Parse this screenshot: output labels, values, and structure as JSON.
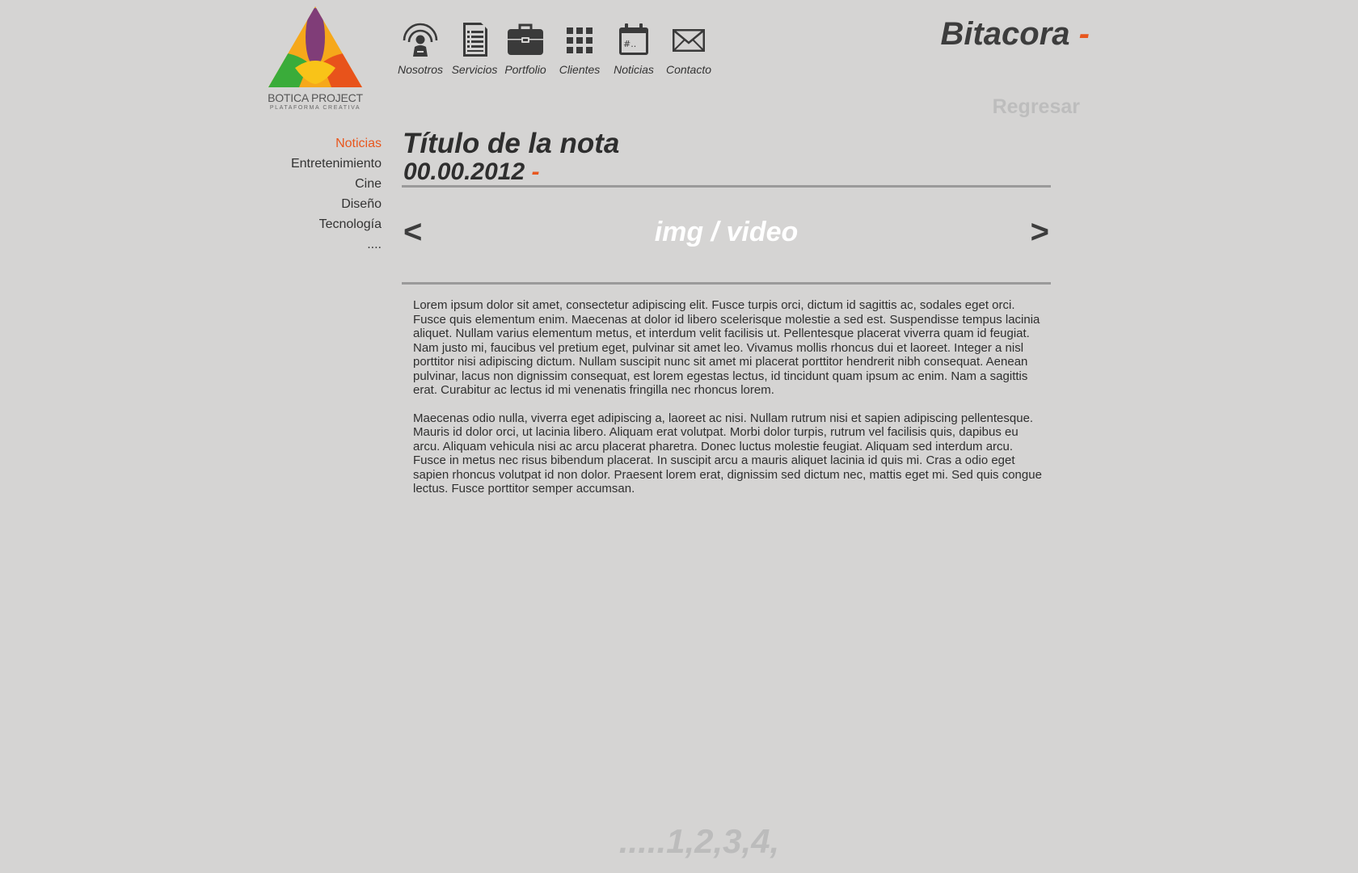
{
  "brand": {
    "name": "BOTICA PROJECT",
    "tagline": "PLATAFORMA CREATIVA"
  },
  "nav": {
    "items": [
      {
        "label": "Nosotros",
        "icon": "person-broadcast-icon"
      },
      {
        "label": "Servicios",
        "icon": "document-list-icon"
      },
      {
        "label": "Portfolio",
        "icon": "briefcase-icon"
      },
      {
        "label": "Clientes",
        "icon": "grid-icon"
      },
      {
        "label": "Noticias",
        "icon": "calendar-icon"
      },
      {
        "label": "Contacto",
        "icon": "envelope-icon"
      }
    ]
  },
  "header": {
    "title": "Bitacora",
    "dash": "-",
    "back_label": "Regresar"
  },
  "sidebar": {
    "items": [
      {
        "label": "Noticias",
        "active": true
      },
      {
        "label": "Entretenimiento",
        "active": false
      },
      {
        "label": "Cine",
        "active": false
      },
      {
        "label": "Diseño",
        "active": false
      },
      {
        "label": "Tecnología",
        "active": false
      },
      {
        "label": "....",
        "active": false
      }
    ]
  },
  "article": {
    "title": "Título de la nota",
    "date": "00.00.2012",
    "date_dash": "-",
    "media": {
      "prev": "<",
      "label": "img / video",
      "next": ">"
    },
    "paragraphs": [
      "Lorem ipsum dolor sit amet, consectetur adipiscing elit. Fusce turpis orci, dictum id sagittis ac, sodales eget orci. Fusce quis elementum enim. Maecenas at dolor id libero scelerisque molestie a sed est. Suspendisse tempus lacinia aliquet. Nullam varius elementum metus, et interdum velit facilisis ut. Pellentesque placerat viverra quam id feugiat. Nam justo mi, faucibus vel pretium eget, pulvinar sit amet leo. Vivamus mollis rhoncus dui et laoreet. Integer a nisl porttitor nisi adipiscing dictum. Nullam suscipit nunc sit amet mi placerat porttitor hendrerit nibh consequat. Aenean pulvinar, lacus non dignissim consequat, est lorem egestas lectus, id tincidunt quam ipsum ac enim. Nam a sagittis erat. Curabitur ac lectus id mi venenatis fringilla nec rhoncus lorem.",
      "Maecenas odio nulla, viverra eget adipiscing a, laoreet ac nisi. Nullam rutrum nisi et sapien adipiscing pellentesque. Mauris id dolor orci, ut lacinia libero. Aliquam erat volutpat. Morbi dolor turpis, rutrum vel facilisis quis, dapibus eu arcu. Aliquam vehicula nisi ac arcu placerat pharetra. Donec luctus molestie feugiat. Aliquam sed interdum arcu. Fusce in metus nec risus bibendum placerat. In suscipit arcu a mauris aliquet lacinia id quis mi. Cras a odio eget sapien rhoncus volutpat id non dolor. Praesent lorem erat, dignissim sed dictum nec, mattis eget mi. Sed quis congue lectus. Fusce porttitor semper accumsan."
    ]
  },
  "pagination": {
    "label": ".....1,2,3,4,"
  },
  "colors": {
    "background": "#d5d4d3",
    "accent": "#e8571e",
    "text": "#3a3a3a",
    "muted": "#bcbcbc"
  }
}
